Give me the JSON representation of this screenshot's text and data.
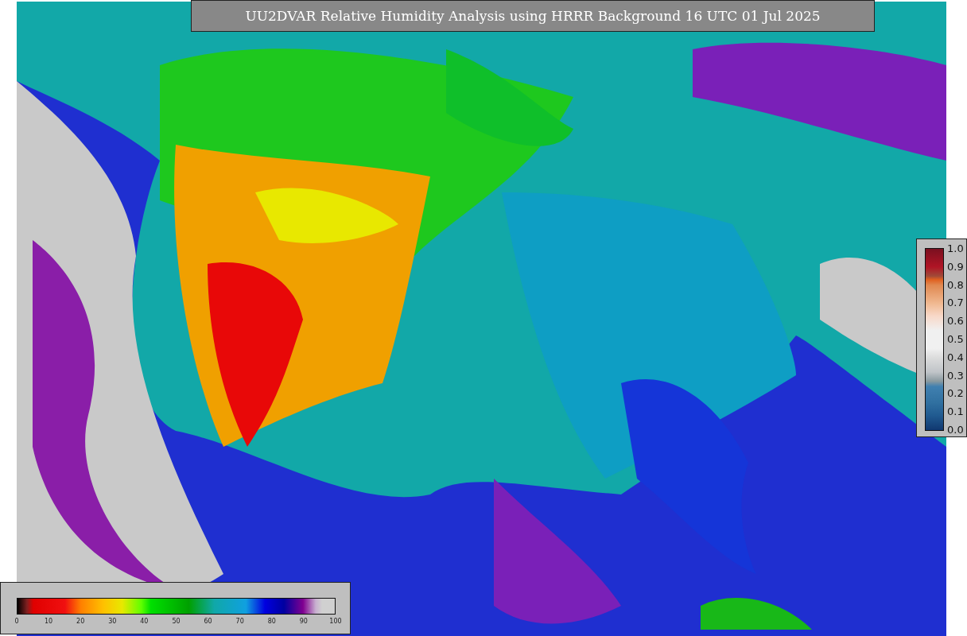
{
  "title": "UU2DVAR Relative Humidity Analysis using HRRR Background 16 UTC 01 Jul 2025",
  "right_colorbar": {
    "ticks": [
      "1.0",
      "0.9",
      "0.8",
      "0.7",
      "0.6",
      "0.5",
      "0.4",
      "0.3",
      "0.2",
      "0.1",
      "0.0"
    ]
  },
  "bottom_colorbar": {
    "ticks": [
      "0",
      "10",
      "20",
      "30",
      "40",
      "50",
      "60",
      "70",
      "80",
      "90",
      "100"
    ]
  }
}
